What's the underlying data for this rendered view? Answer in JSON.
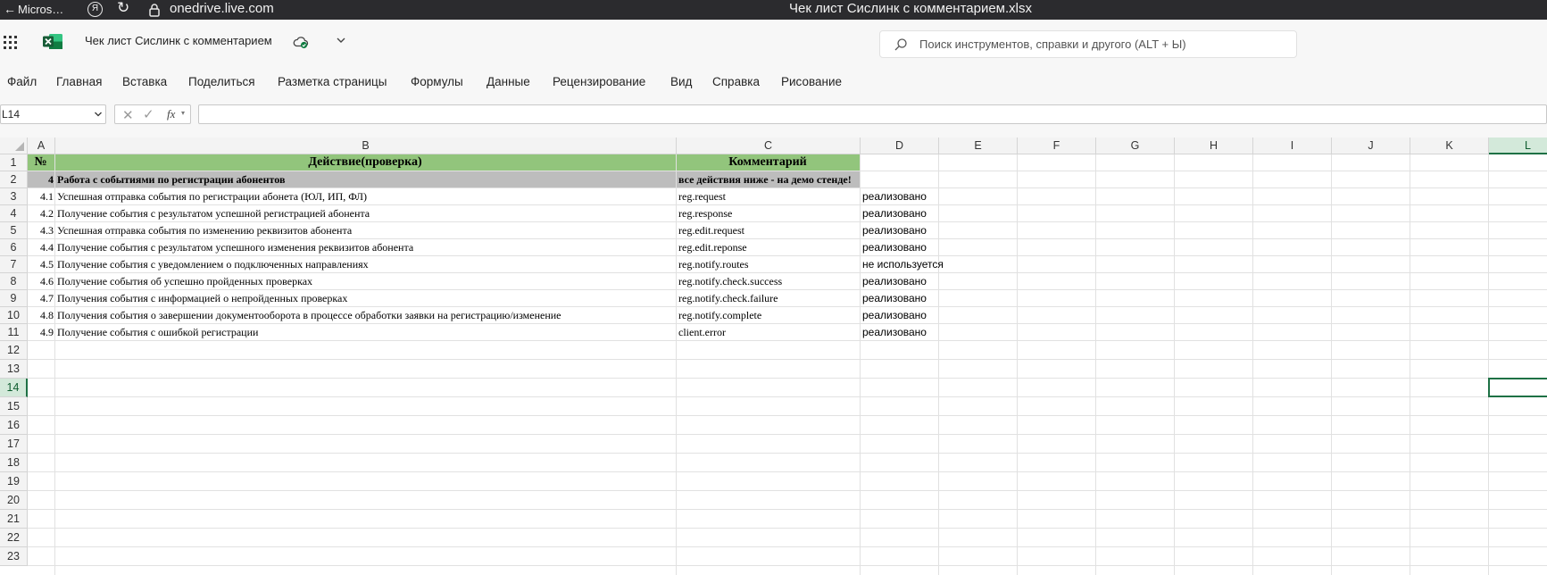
{
  "browser": {
    "back_label": "Micros…",
    "url": "onedrive.live.com",
    "title": "Чек лист Сислинк с комментарием.xlsx"
  },
  "app": {
    "doc_name": "Чек лист Сислинк с комментарием",
    "search_placeholder": "Поиск инструментов, справки и другого (ALT + Ы)"
  },
  "menu": [
    "Файл",
    "Главная",
    "Вставка",
    "Поделиться",
    "Разметка страницы",
    "Формулы",
    "Данные",
    "Рецензирование",
    "Вид",
    "Справка",
    "Рисование"
  ],
  "formula_bar": {
    "name_box": "L14",
    "fx": "fx",
    "value": ""
  },
  "columns": [
    "A",
    "B",
    "C",
    "D",
    "E",
    "F",
    "G",
    "H",
    "I",
    "J",
    "K",
    "L"
  ],
  "selected": {
    "col": "L",
    "row": "14"
  },
  "rows": [
    "1",
    "2",
    "3",
    "4",
    "5",
    "6",
    "7",
    "8",
    "9",
    "10",
    "11",
    "12",
    "13",
    "14",
    "15",
    "16",
    "17",
    "18",
    "19",
    "20",
    "21",
    "22",
    "23"
  ],
  "sheet": {
    "header": {
      "a": "№",
      "b": "Действие(проверка)",
      "c": "Комментарий"
    },
    "section": {
      "a": "4",
      "b": "Работа с событиями по регистрации абонентов",
      "c": "все действия ниже - на демо стенде!"
    },
    "items": [
      {
        "a": "4.1",
        "b": "Успешная отправка события по регистрации абонета (ЮЛ, ИП, ФЛ)",
        "c": "reg.request",
        "d": "реализовано"
      },
      {
        "a": "4.2",
        "b": "Получение события с результатом успешной регистрацией абонента",
        "c": "reg.response",
        "d": "реализовано"
      },
      {
        "a": "4.3",
        "b": "Успешная отправка события по изменению реквизитов абонента",
        "c": "reg.edit.request",
        "d": "реализовано"
      },
      {
        "a": "4.4",
        "b": "Получение события с результатом успешного изменения реквизитов абонента",
        "c": "reg.edit.reponse",
        "d": "реализовано"
      },
      {
        "a": "4.5",
        "b": "Получение события с уведомлением о подключенных направлениях",
        "c": "reg.notify.routes",
        "d": "не используется"
      },
      {
        "a": "4.6",
        "b": "Получение события об успешно пройденных проверках",
        "c": "reg.notify.check.success",
        "d": "реализовано"
      },
      {
        "a": "4.7",
        "b": "Получения события с информацией о непройденных проверках",
        "c": "reg.notify.check.failure",
        "d": "реализовано"
      },
      {
        "a": "4.8",
        "b": "Получения события о завершении документооборота в процессе обработки заявки на регистрацию/изменение",
        "c": "reg.notify.complete",
        "d": "реализовано"
      },
      {
        "a": "4.9",
        "b": "Получение события с ошибкой регистрации",
        "c": "client.error",
        "d": "реализовано"
      }
    ]
  }
}
